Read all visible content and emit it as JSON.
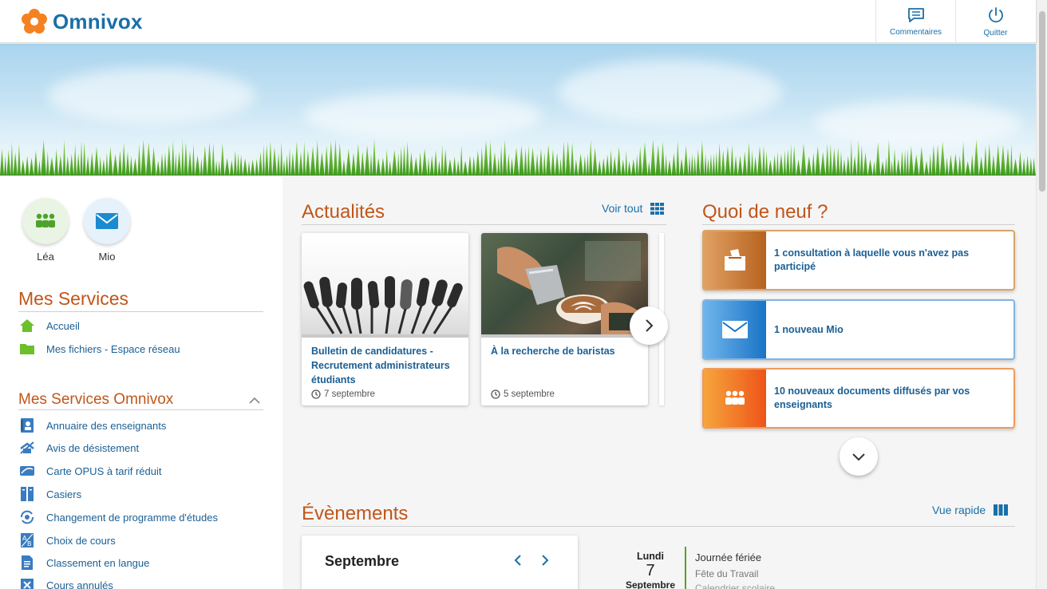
{
  "app": {
    "logo_text": "Omnivox"
  },
  "header": {
    "comments_label": "Commentaires",
    "quit_label": "Quitter"
  },
  "quick_access": [
    {
      "label": "Léa",
      "icon": "people-icon",
      "color": "#4ca32b"
    },
    {
      "label": "Mio",
      "icon": "mail-icon",
      "color": "#1a8ad1"
    }
  ],
  "mes_services": {
    "title": "Mes Services",
    "items": [
      {
        "label": "Accueil",
        "icon": "home-icon"
      },
      {
        "label": "Mes fichiers - Espace réseau",
        "icon": "folder-icon"
      }
    ]
  },
  "mes_services_omnivox": {
    "title": "Mes Services Omnivox",
    "items": [
      {
        "label": "Annuaire des enseignants",
        "icon": "directory-icon"
      },
      {
        "label": "Avis de désistement",
        "icon": "withdrawal-icon"
      },
      {
        "label": "Carte OPUS à tarif réduit",
        "icon": "card-icon"
      },
      {
        "label": "Casiers",
        "icon": "locker-icon"
      },
      {
        "label": "Changement de programme d'études",
        "icon": "change-program-icon"
      },
      {
        "label": "Choix de cours",
        "icon": "course-choice-icon"
      },
      {
        "label": "Classement en langue",
        "icon": "language-ranking-icon"
      },
      {
        "label": "Cours annulés",
        "icon": "cancelled-courses-icon"
      }
    ]
  },
  "actualites": {
    "title": "Actualités",
    "see_all": "Voir tout",
    "cards": [
      {
        "title": "Bulletin de candidatures - Recrutement administrateurs étudiants",
        "date": "7 septembre"
      },
      {
        "title": "À la recherche de baristas",
        "date": "5 septembre"
      }
    ]
  },
  "quoi_de_neuf": {
    "title": "Quoi de neuf ?",
    "items": [
      {
        "text": "1 consultation à laquelle vous n'avez pas participé",
        "icon": "ballot-box-icon",
        "color": "#c0561a"
      },
      {
        "text": "1 nouveau Mio",
        "icon": "mail-icon",
        "color": "#1a7fcc"
      },
      {
        "text": "10 nouveaux documents diffusés par vos enseignants",
        "icon": "people-icon",
        "color": "#f26c1a"
      }
    ]
  },
  "evenements": {
    "title": "Évènements",
    "quick_view": "Vue rapide",
    "calendar_month": "Septembre",
    "event": {
      "day_name": "Lundi",
      "day_num": "7",
      "month": "Septembre",
      "title": "Journée fériée",
      "subtitle": "Fête du Travail",
      "category": "Calendrier scolaire"
    }
  }
}
